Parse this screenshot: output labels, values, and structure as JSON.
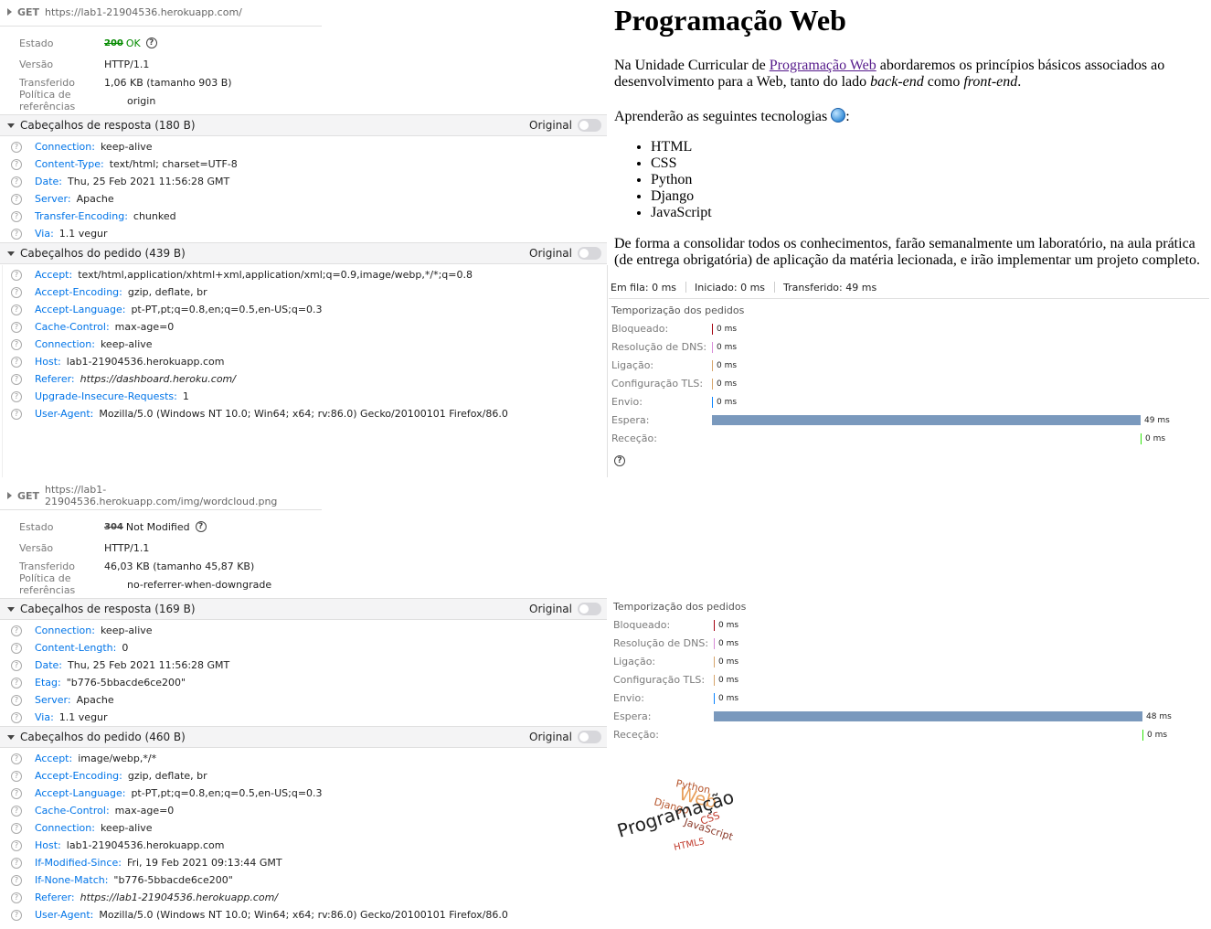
{
  "req1": {
    "method": "GET",
    "url": "https://lab1-21904536.herokuapp.com/",
    "summary": {
      "estado_label": "Estado",
      "estado_code": "200",
      "estado_text": "OK",
      "versao_label": "Versão",
      "versao": "HTTP/1.1",
      "transferido_label": "Transferido",
      "transferido": "1,06 KB (tamanho 903 B)",
      "politica_label": "Política de referências",
      "politica": "origin"
    },
    "resp_title": "Cabeçalhos de resposta (180 B)",
    "req_title": "Cabeçalhos do pedido (439 B)",
    "original_label": "Original",
    "resp_headers": [
      {
        "name": "Connection:",
        "value": "keep-alive"
      },
      {
        "name": "Content-Type:",
        "value": "text/html; charset=UTF-8"
      },
      {
        "name": "Date:",
        "value": "Thu, 25 Feb 2021 11:56:28 GMT"
      },
      {
        "name": "Server:",
        "value": "Apache"
      },
      {
        "name": "Transfer-Encoding:",
        "value": "chunked"
      },
      {
        "name": "Via:",
        "value": "1.1 vegur"
      }
    ],
    "req_headers": [
      {
        "name": "Accept:",
        "value": "text/html,application/xhtml+xml,application/xml;q=0.9,image/webp,*/*;q=0.8"
      },
      {
        "name": "Accept-Encoding:",
        "value": "gzip, deflate, br"
      },
      {
        "name": "Accept-Language:",
        "value": "pt-PT,pt;q=0.8,en;q=0.5,en-US;q=0.3"
      },
      {
        "name": "Cache-Control:",
        "value": "max-age=0"
      },
      {
        "name": "Connection:",
        "value": "keep-alive"
      },
      {
        "name": "Host:",
        "value": "lab1-21904536.herokuapp.com"
      },
      {
        "name": "Referer:",
        "value": "https://dashboard.heroku.com/"
      },
      {
        "name": "Upgrade-Insecure-Requests:",
        "value": "1"
      },
      {
        "name": "User-Agent:",
        "value": "Mozilla/5.0 (Windows NT 10.0; Win64; x64; rv:86.0) Gecko/20100101 Firefox/86.0"
      }
    ]
  },
  "req2": {
    "method": "GET",
    "url": "https://lab1-21904536.herokuapp.com/img/wordcloud.png",
    "summary": {
      "estado_label": "Estado",
      "estado_code": "304",
      "estado_text": "Not Modified",
      "versao_label": "Versão",
      "versao": "HTTP/1.1",
      "transferido_label": "Transferido",
      "transferido": "46,03 KB (tamanho 45,87 KB)",
      "politica_label": "Política de referências",
      "politica": "no-referrer-when-downgrade"
    },
    "resp_title": "Cabeçalhos de resposta (169 B)",
    "req_title": "Cabeçalhos do pedido (460 B)",
    "original_label": "Original",
    "resp_headers": [
      {
        "name": "Connection:",
        "value": "keep-alive"
      },
      {
        "name": "Content-Length:",
        "value": "0"
      },
      {
        "name": "Date:",
        "value": "Thu, 25 Feb 2021 11:56:28 GMT"
      },
      {
        "name": "Etag:",
        "value": "\"b776-5bbacde6ce200\""
      },
      {
        "name": "Server:",
        "value": "Apache"
      },
      {
        "name": "Via:",
        "value": "1.1 vegur"
      }
    ],
    "req_headers": [
      {
        "name": "Accept:",
        "value": "image/webp,*/*"
      },
      {
        "name": "Accept-Encoding:",
        "value": "gzip, deflate, br"
      },
      {
        "name": "Accept-Language:",
        "value": "pt-PT,pt;q=0.8,en;q=0.5,en-US;q=0.3"
      },
      {
        "name": "Cache-Control:",
        "value": "max-age=0"
      },
      {
        "name": "Connection:",
        "value": "keep-alive"
      },
      {
        "name": "Host:",
        "value": "lab1-21904536.herokuapp.com"
      },
      {
        "name": "If-Modified-Since:",
        "value": "Fri, 19 Feb 2021 09:13:44 GMT"
      },
      {
        "name": "If-None-Match:",
        "value": "\"b776-5bbacde6ce200\""
      },
      {
        "name": "Referer:",
        "value": "https://lab1-21904536.herokuapp.com/"
      },
      {
        "name": "User-Agent:",
        "value": "Mozilla/5.0 (Windows NT 10.0; Win64; x64; rv:86.0) Gecko/20100101 Firefox/86.0"
      }
    ]
  },
  "page": {
    "title": "Programação Web",
    "p1_a": "Na Unidade Curricular de ",
    "p1_link": "Programação Web",
    "p1_b": " abordaremos os princípios básicos associados ao desenvolvimento para a Web, tanto do lado ",
    "p1_i1": "back-end",
    "p1_c": " como ",
    "p1_i2": "front-end",
    "p1_d": ".",
    "p2": "Aprenderão as seguintes tecnologias",
    "p2_end": ":",
    "techs": [
      "HTML",
      "CSS",
      "Python",
      "Django",
      "JavaScript"
    ],
    "p3": "De forma a consolidar todos os conhecimentos, farão semanalmente um laboratório, na aula prática (de entrega obrigatória) de aplicação da matéria lecionada, e irão implementar um projeto completo."
  },
  "timing_summary": {
    "em_fila": "Em fila: 0 ms",
    "iniciado": "Iniciado: 0 ms",
    "transferido": "Transferido: 49 ms"
  },
  "timings1": {
    "title": "Temporização dos pedidos",
    "rows": [
      {
        "label": "Bloqueado:",
        "value": "0 ms",
        "color": "#a4000f"
      },
      {
        "label": "Resolução de DNS:",
        "value": "0 ms",
        "color": "#d88ad8"
      },
      {
        "label": "Ligação:",
        "value": "0 ms",
        "color": "#d7a56b"
      },
      {
        "label": "Configuração TLS:",
        "value": "0 ms",
        "color": "#d7a56b"
      },
      {
        "label": "Envio:",
        "value": "0 ms",
        "color": "#0a84ff"
      },
      {
        "label": "Espera:",
        "value": "49 ms",
        "color": "#7a99bd"
      },
      {
        "label": "Receção:",
        "value": "0 ms",
        "color": "#30e60b"
      }
    ],
    "total_ms": 49
  },
  "timings2": {
    "title": "Temporização dos pedidos",
    "rows": [
      {
        "label": "Bloqueado:",
        "value": "0 ms",
        "color": "#a4000f"
      },
      {
        "label": "Resolução de DNS:",
        "value": "0 ms",
        "color": "#d88ad8"
      },
      {
        "label": "Ligação:",
        "value": "0 ms",
        "color": "#d7a56b"
      },
      {
        "label": "Configuração TLS:",
        "value": "0 ms",
        "color": "#d7a56b"
      },
      {
        "label": "Envio:",
        "value": "0 ms",
        "color": "#0a84ff"
      },
      {
        "label": "Espera:",
        "value": "48 ms",
        "color": "#7a99bd"
      },
      {
        "label": "Receção:",
        "value": "0 ms",
        "color": "#30e60b"
      }
    ],
    "total_ms": 48
  },
  "wordcloud": {
    "words": [
      "Python",
      "Web",
      "Django",
      "Programação",
      "CSS",
      "JavaScript",
      "HTML5"
    ]
  }
}
